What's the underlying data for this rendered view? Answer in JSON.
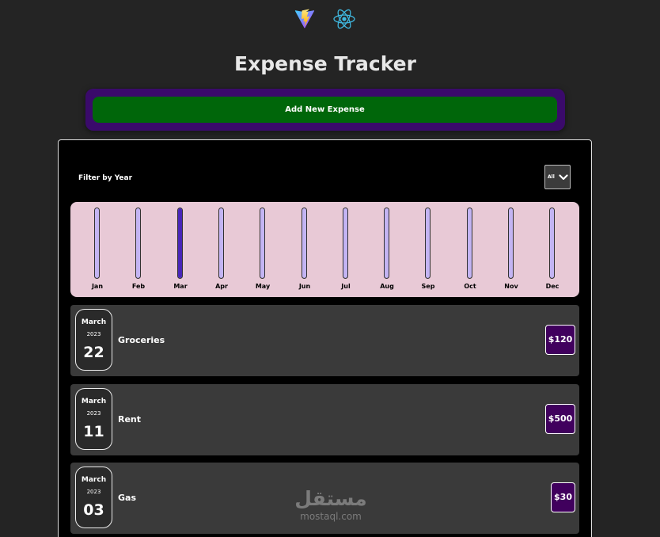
{
  "header": {
    "logos": {
      "vite": "vite-logo-icon",
      "react": "react-logo-icon"
    },
    "title": "Expense Tracker"
  },
  "new_expense": {
    "add_label": "Add New Expense"
  },
  "filter": {
    "label": "Filter by Year",
    "selected": "All",
    "chevron": "chevron-down-icon"
  },
  "chart_data": {
    "type": "bar",
    "categories": [
      "Jan",
      "Feb",
      "Mar",
      "Apr",
      "May",
      "Jun",
      "Jul",
      "Aug",
      "Sep",
      "Oct",
      "Nov",
      "Dec"
    ],
    "values": [
      0,
      0,
      650,
      0,
      0,
      0,
      0,
      0,
      0,
      0,
      0,
      0
    ],
    "max": 650
  },
  "expenses": [
    {
      "month": "March",
      "year": "2023",
      "day": "22",
      "title": "Groceries",
      "amount": "$120"
    },
    {
      "month": "March",
      "year": "2023",
      "day": "11",
      "title": "Rent",
      "amount": "$500"
    },
    {
      "month": "March",
      "year": "2023",
      "day": "03",
      "title": "Gas",
      "amount": "$30"
    }
  ],
  "watermark": {
    "arabic": "مستقل",
    "latin": "mostaql.com"
  },
  "colors": {
    "background": "#242424",
    "card": "#000000",
    "add_button": "#00660a",
    "new_expense_panel": "#3a0a6b",
    "chart_bg": "#e8c9d6",
    "bar_track": "#c3b4f3",
    "bar_fill": "#4826b9",
    "item_bg": "#3a3a3a",
    "price_bg": "#40005d"
  }
}
